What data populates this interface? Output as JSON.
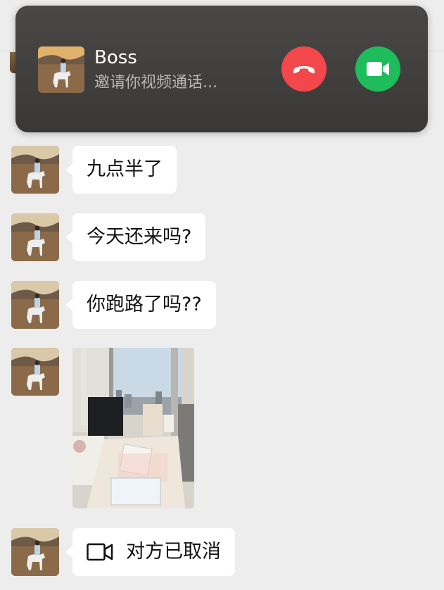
{
  "call": {
    "caller_name": "Boss",
    "status": "邀请你视频通话..."
  },
  "messages": [
    {
      "type": "text",
      "text": "九点半了"
    },
    {
      "type": "text",
      "text": "今天还来吗?"
    },
    {
      "type": "text",
      "text": "你跑路了吗??"
    },
    {
      "type": "image"
    },
    {
      "type": "call",
      "text": "对方已取消",
      "icon": "video-camera-icon"
    }
  ],
  "colors": {
    "background": "#ededed",
    "bubble": "#ffffff",
    "decline": "#f3484b",
    "accept": "#1fbc5c",
    "banner": "#3f3d3c"
  }
}
